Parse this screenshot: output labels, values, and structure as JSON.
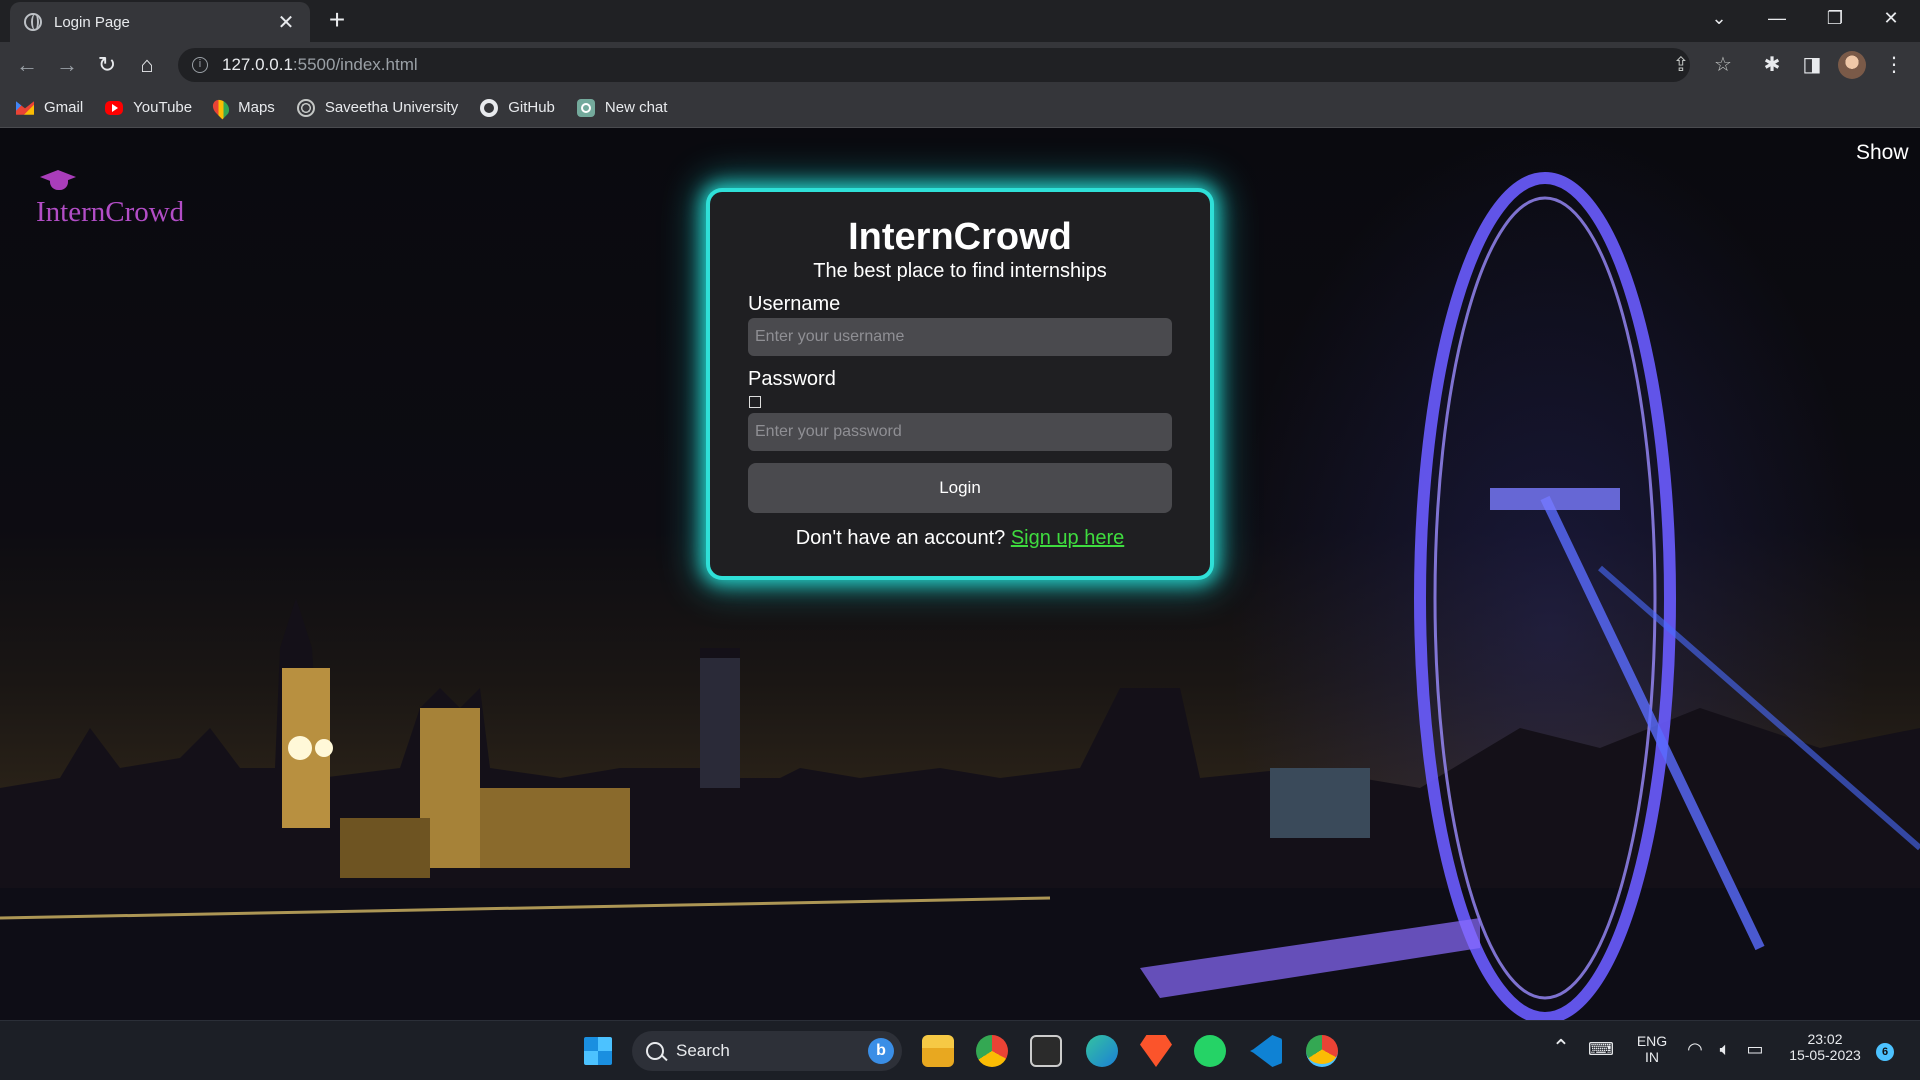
{
  "browser": {
    "tab_title": "Login Page",
    "tab_close": "✕",
    "new_tab": "+",
    "window_controls": {
      "tab_search": "⌄",
      "minimize": "—",
      "restore": "❐",
      "close": "✕"
    },
    "nav": {
      "back": "←",
      "forward": "→",
      "reload": "↻",
      "home": "⌂"
    },
    "url": {
      "info_icon": "i",
      "host": "127.0.0.1",
      "path": ":5500/index.html"
    },
    "toolbar_icons": {
      "share": "⇪",
      "bookmark_star": "☆",
      "extensions": "✱",
      "side_panel": "◨",
      "menu": "⋮"
    },
    "bookmarks": [
      {
        "label": "Gmail",
        "icon": "gmail-icon",
        "color": "#ea4335"
      },
      {
        "label": "YouTube",
        "icon": "youtube-icon",
        "color": "#ff0000"
      },
      {
        "label": "Maps",
        "icon": "maps-icon",
        "color": "#34a853"
      },
      {
        "label": "Saveetha University",
        "icon": "globe-icon",
        "color": "#9aa0a6"
      },
      {
        "label": "GitHub",
        "icon": "github-icon",
        "color": "#e8eaed"
      },
      {
        "label": "New chat",
        "icon": "chatgpt-icon",
        "color": "#74aa9c"
      }
    ]
  },
  "page": {
    "logo_text": "InternCrowd",
    "show_link": "Show",
    "card": {
      "title": "InternCrowd",
      "tagline": "The best place to find internships",
      "username_label": "Username",
      "username_placeholder": "Enter your username",
      "username_value": "",
      "password_label": "Password",
      "password_placeholder": "Enter your password",
      "password_value": "",
      "login_button": "Login",
      "signup_prompt": "Don't have an account?",
      "signup_link": "Sign up here"
    },
    "colors": {
      "accent_glow": "#2fe0d8",
      "logo": "#b24dc6",
      "link": "#3fdc3f",
      "card_bg": "#1f1f22"
    }
  },
  "taskbar": {
    "search_label": "Search",
    "bing_letter": "b",
    "apps": [
      "windows-start-icon",
      "file-explorer-icon",
      "chrome-icon",
      "terminal-icon",
      "edge-icon",
      "brave-icon",
      "whatsapp-icon",
      "vscode-icon",
      "chrome-profile-icon"
    ],
    "language_line1": "ENG",
    "language_line2": "IN",
    "time": "23:02",
    "date": "15-05-2023",
    "notification_count": "6"
  }
}
